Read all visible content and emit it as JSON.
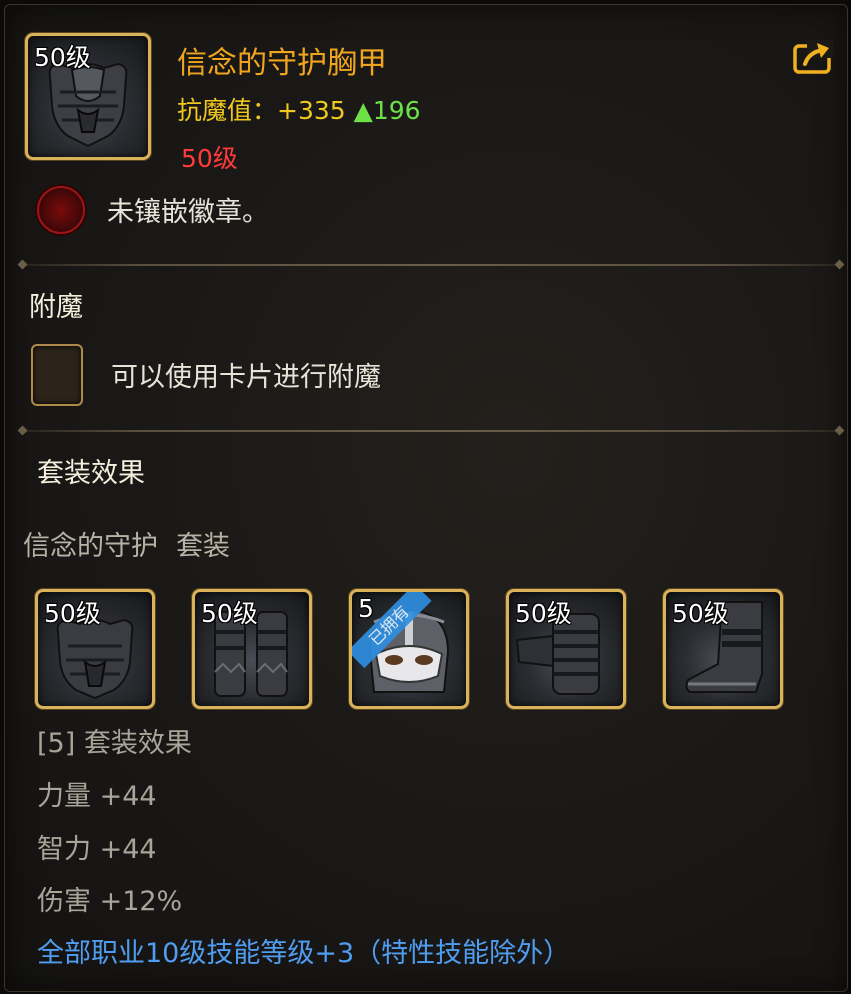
{
  "item": {
    "icon": "chest-armor-icon",
    "icon_level": "50级",
    "name": "信念的守护胸甲",
    "stat_label": "抗魔值：",
    "stat_value": "+335",
    "stat_increase_arrow": "▲",
    "stat_increase": "196",
    "required_level": "50级",
    "external_link_icon": "external-link-icon"
  },
  "badge": {
    "icon": "empty-badge-slot-icon",
    "text": "未镶嵌徽章。"
  },
  "enchant": {
    "heading": "附魔",
    "icon": "card-slot-icon",
    "text": "可以使用卡片进行附魔"
  },
  "set": {
    "heading": "套装效果",
    "name": "信念的守护",
    "suffix": "套装",
    "pieces": [
      {
        "level": "50级",
        "icon": "chest-armor-icon"
      },
      {
        "level": "50级",
        "icon": "leg-armor-icon"
      },
      {
        "level": "5",
        "icon": "helmet-icon",
        "tag": "已拥有"
      },
      {
        "level": "50级",
        "icon": "gauntlet-icon"
      },
      {
        "level": "50级",
        "icon": "boots-icon"
      }
    ],
    "effects": {
      "header": "[5] 套装效果",
      "line1": "力量 +44",
      "line2": "智力 +44",
      "line3": "伤害 +12%",
      "line4": "全部职业10级技能等级+3（特性技能除外）"
    }
  },
  "colors": {
    "title": "#f0a51e",
    "stat": "#f0c81e",
    "increase": "#6ee048",
    "required_level": "#ff3a3a",
    "frame_gold": "#d9b25a",
    "skill_bonus": "#4f9df0"
  }
}
